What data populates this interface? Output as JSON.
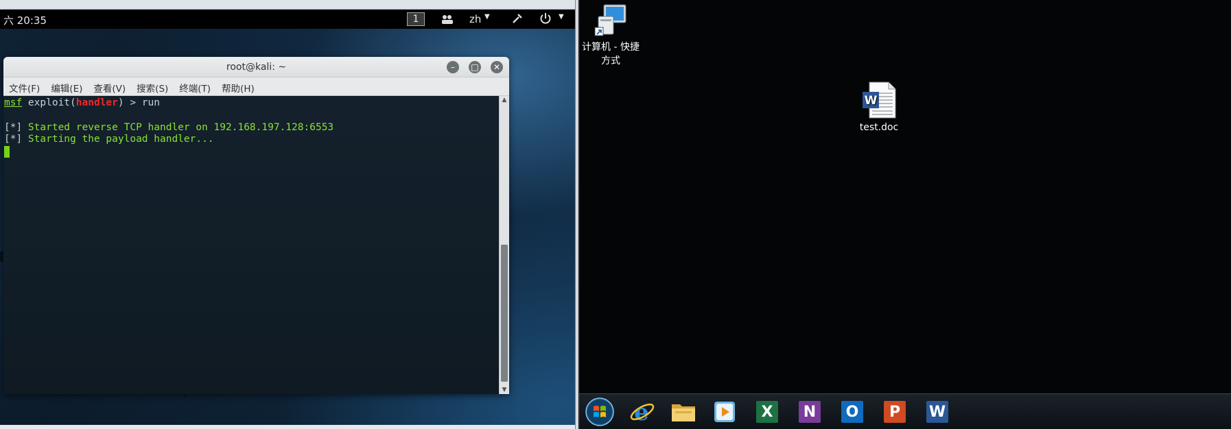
{
  "kali": {
    "topbar": {
      "clock": "六 20:35",
      "workspace": "1",
      "language": "zh"
    },
    "terminal": {
      "title": "root@kali: ~",
      "menu": [
        "文件(F)",
        "编辑(E)",
        "查看(V)",
        "搜索(S)",
        "终端(T)",
        "帮助(H)"
      ],
      "prompt_prefix": "msf",
      "prompt_cmd": " exploit(",
      "prompt_module": "handler",
      "prompt_suffix": ") > run",
      "output": [
        {
          "tag": "[*]",
          "text": " Started reverse TCP handler on 192.168.197.128:6553"
        },
        {
          "tag": "[*]",
          "text": " Starting the payload handler..."
        }
      ]
    }
  },
  "windows": {
    "desktop_icons": [
      {
        "label_line1": "计算机 - 快捷",
        "label_line2": "方式",
        "icon": "computer-shortcut-icon"
      },
      {
        "label_line1": "test.doc",
        "icon": "word-document-icon"
      }
    ],
    "taskbar": [
      {
        "icon": "start-orb-icon"
      },
      {
        "icon": "internet-explorer-icon"
      },
      {
        "icon": "file-explorer-icon"
      },
      {
        "icon": "media-player-icon"
      },
      {
        "icon": "excel-icon",
        "letter": "X",
        "color": "#1e7145"
      },
      {
        "icon": "onenote-icon",
        "letter": "N",
        "color": "#7a3b9b"
      },
      {
        "icon": "outlook-icon",
        "letter": "O",
        "color": "#0f6bbd"
      },
      {
        "icon": "powerpoint-icon",
        "letter": "P",
        "color": "#d04a22"
      },
      {
        "icon": "word-icon",
        "letter": "W",
        "color": "#2b5797"
      }
    ]
  }
}
